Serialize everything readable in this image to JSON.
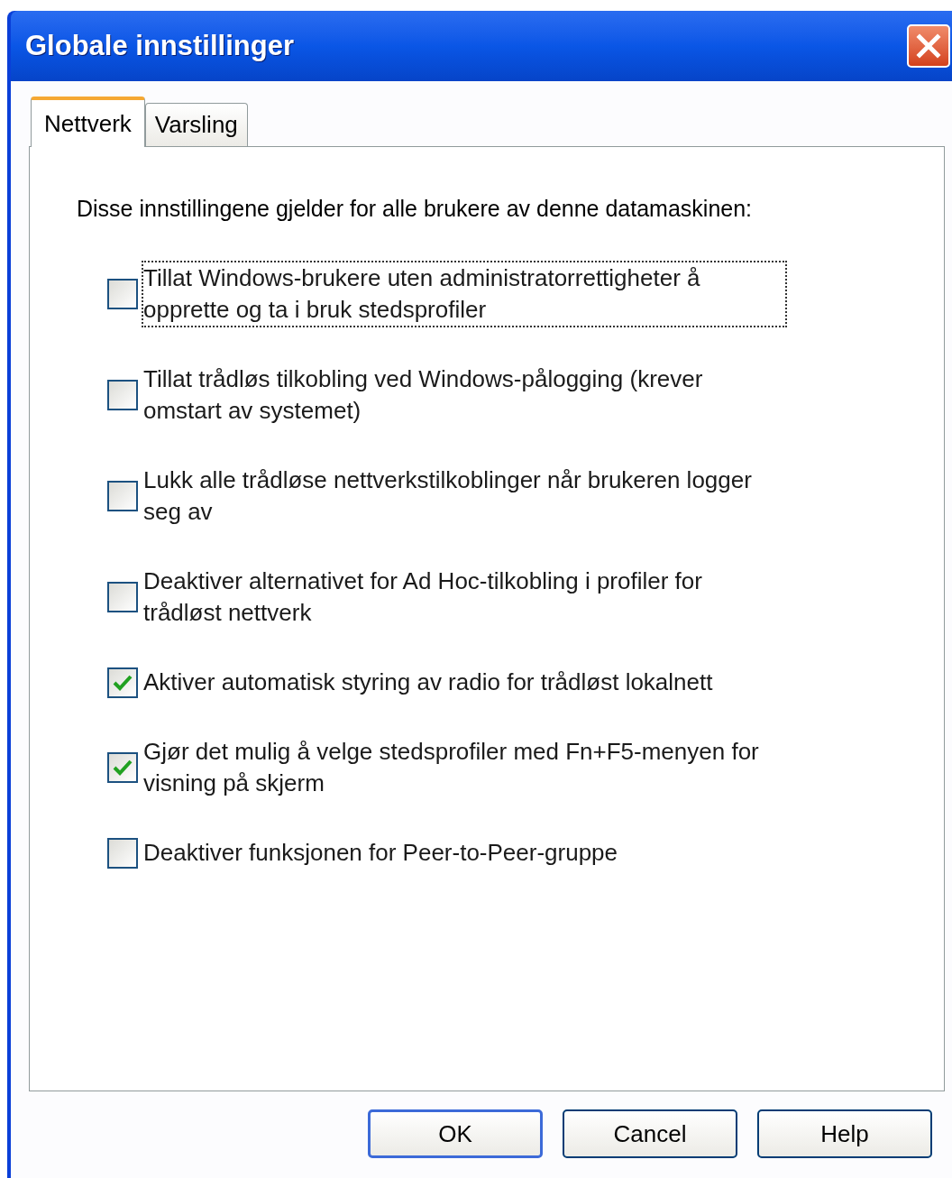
{
  "window": {
    "title": "Globale innstillinger"
  },
  "tabs": [
    {
      "label": "Nettverk",
      "selected": true
    },
    {
      "label": "Varsling",
      "selected": false
    }
  ],
  "intro": "Disse innstillingene gjelder for alle brukere av denne datamaskinen:",
  "options": [
    {
      "label": "Tillat Windows-brukere uten administratorrettigheter å opprette og ta i bruk stedsprofiler",
      "checked": false,
      "focused": true
    },
    {
      "label": "Tillat trådløs tilkobling ved Windows-pålogging (krever omstart av systemet)",
      "checked": false,
      "focused": false
    },
    {
      "label": "Lukk alle trådløse nettverkstilkoblinger når brukeren logger seg av",
      "checked": false,
      "focused": false
    },
    {
      "label": "Deaktiver alternativet for Ad Hoc-tilkobling i profiler for trådløst nettverk",
      "checked": false,
      "focused": false
    },
    {
      "label": "Aktiver automatisk styring av radio for trådløst lokalnett",
      "checked": true,
      "focused": false
    },
    {
      "label": "Gjør det mulig å velge stedsprofiler med Fn+F5-menyen for visning på skjerm",
      "checked": true,
      "focused": false
    },
    {
      "label": "Deaktiver funksjonen for Peer-to-Peer-gruppe",
      "checked": false,
      "focused": false
    }
  ],
  "buttons": [
    {
      "label": "OK",
      "default": true
    },
    {
      "label": "Cancel",
      "default": false
    },
    {
      "label": "Help",
      "default": false
    }
  ]
}
